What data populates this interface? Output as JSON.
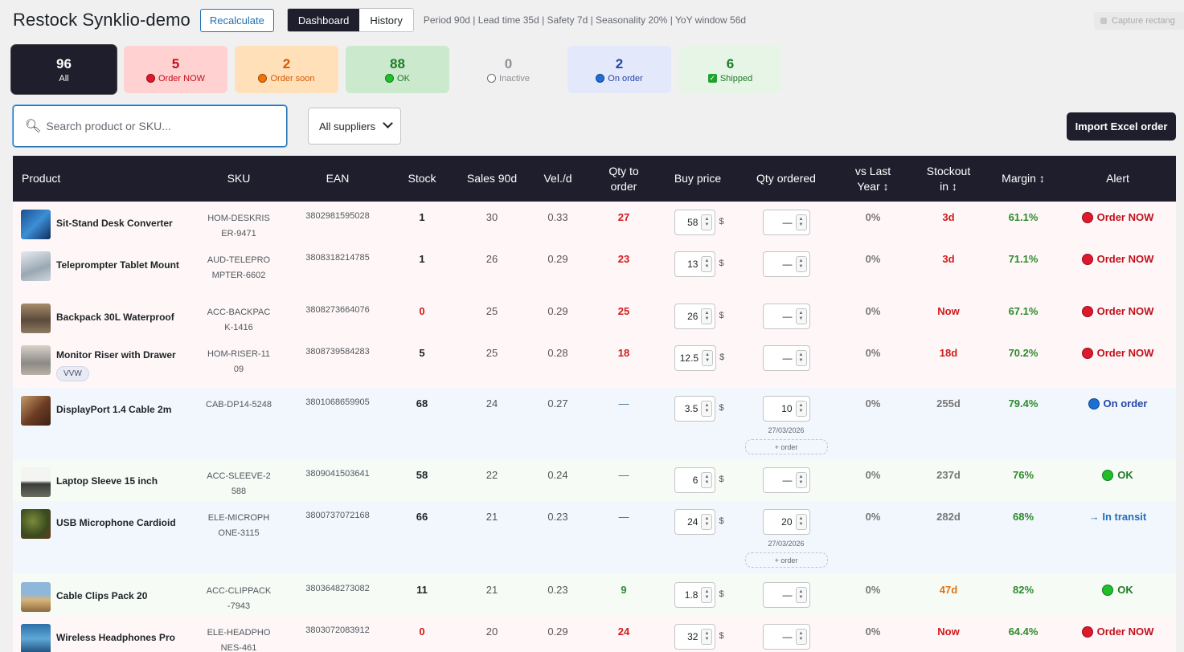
{
  "header": {
    "title": "Restock Synklio-demo",
    "recalculate_label": "Recalculate",
    "tabs": [
      {
        "label": "Dashboard",
        "active": true
      },
      {
        "label": "History",
        "active": false
      }
    ],
    "params": "Period 90d | Lead time 35d | Safety 7d | Seasonality 20% | YoY window 56d",
    "capture_label": "Capture rectang"
  },
  "cards": [
    {
      "count": "96",
      "label": "All"
    },
    {
      "count": "5",
      "label": "Order NOW",
      "icon": "red-dot-icon"
    },
    {
      "count": "2",
      "label": "Order soon",
      "icon": "orange-dot-icon"
    },
    {
      "count": "88",
      "label": "OK",
      "icon": "green-dot-icon"
    },
    {
      "count": "0",
      "label": "Inactive",
      "icon": "empty-circle-icon"
    },
    {
      "count": "2",
      "label": "On order",
      "icon": "blue-dot-icon"
    },
    {
      "count": "6",
      "label": "Shipped",
      "icon": "check-box-icon"
    }
  ],
  "filters": {
    "search_placeholder": "Search product or SKU...",
    "supplier_selected": "All suppliers",
    "import_label": "Import Excel order"
  },
  "table": {
    "columns": [
      "Product",
      "SKU",
      "EAN",
      "Stock",
      "Sales 90d",
      "Vel./d",
      "Qty to order",
      "Buy price",
      "Qty ordered",
      "vs Last Year ↕",
      "Stockout in ↕",
      "Margin ↕",
      "Alert"
    ],
    "currency": "$",
    "add_order_label": "+ order",
    "rows": [
      {
        "product": "Sit-Stand Desk Converter",
        "sku": "HOM-DESKRISER-9471",
        "ean": "3802981595028",
        "stock": "1",
        "sales": "30",
        "vel": "0.33",
        "qty": "27",
        "price": "58",
        "ordered": "—",
        "yoy": "0%",
        "stockout": "3d",
        "margin": "61.1%",
        "alert": "Order NOW"
      },
      {
        "product": "Teleprompter Tablet Mount",
        "sku": "AUD-TELEPROMPTER-6602",
        "ean": "3808318214785",
        "stock": "1",
        "sales": "26",
        "vel": "0.29",
        "qty": "23",
        "price": "13",
        "ordered": "—",
        "yoy": "0%",
        "stockout": "3d",
        "margin": "71.1%",
        "alert": "Order NOW"
      },
      {
        "product": "Backpack 30L Waterproof",
        "sku": "ACC-BACKPACK-1416",
        "ean": "3808273664076",
        "stock": "0",
        "sales": "25",
        "vel": "0.29",
        "qty": "25",
        "price": "26",
        "ordered": "—",
        "yoy": "0%",
        "stockout": "Now",
        "margin": "67.1%",
        "alert": "Order NOW"
      },
      {
        "product": "Monitor Riser with Drawer",
        "tag": "VVW",
        "sku": "HOM-RISER-1109",
        "ean": "3808739584283",
        "stock": "5",
        "sales": "25",
        "vel": "0.28",
        "qty": "18",
        "price": "12.5",
        "ordered": "—",
        "yoy": "0%",
        "stockout": "18d",
        "margin": "70.2%",
        "alert": "Order NOW"
      },
      {
        "product": "DisplayPort 1.4 Cable 2m",
        "sku": "CAB-DP14-5248",
        "ean": "3801068659905",
        "stock": "68",
        "sales": "24",
        "vel": "0.27",
        "qty": "—",
        "price": "3.5",
        "ordered": "10",
        "ordered_date": "27/03/2026",
        "yoy": "0%",
        "stockout": "255d",
        "margin": "79.4%",
        "alert": "On order"
      },
      {
        "product": "Laptop Sleeve 15 inch",
        "sku": "ACC-SLEEVE-2588",
        "ean": "3809041503641",
        "stock": "58",
        "sales": "22",
        "vel": "0.24",
        "qty": "—",
        "price": "6",
        "ordered": "—",
        "yoy": "0%",
        "stockout": "237d",
        "margin": "76%",
        "alert": "OK"
      },
      {
        "product": "USB Microphone Cardioid",
        "sku": "ELE-MICROPHONE-3115",
        "ean": "3800737072168",
        "stock": "66",
        "sales": "21",
        "vel": "0.23",
        "qty": "—",
        "price": "24",
        "ordered": "20",
        "ordered_date": "27/03/2026",
        "yoy": "0%",
        "stockout": "282d",
        "margin": "68%",
        "alert": "→ In transit"
      },
      {
        "product": "Cable Clips Pack 20",
        "sku": "ACC-CLIPPACK-7943",
        "ean": "3803648273082",
        "stock": "11",
        "sales": "21",
        "vel": "0.23",
        "qty": "9",
        "price": "1.8",
        "ordered": "—",
        "yoy": "0%",
        "stockout": "47d",
        "margin": "82%",
        "alert": "OK"
      },
      {
        "product": "Wireless Headphones Pro",
        "sku": "ELE-HEADPHONES-461",
        "ean": "3803072083912",
        "stock": "0",
        "sales": "20",
        "vel": "0.29",
        "qty": "24",
        "price": "32",
        "ordered": "—",
        "yoy": "0%",
        "stockout": "Now",
        "margin": "64.4%",
        "alert": "Order NOW"
      }
    ]
  }
}
